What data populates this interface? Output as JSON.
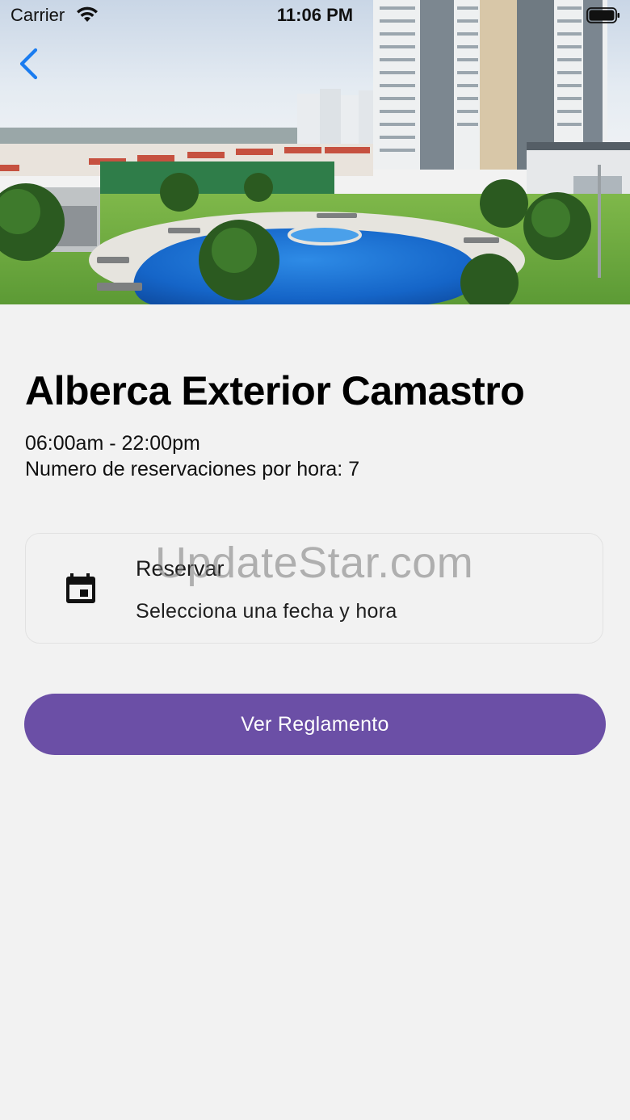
{
  "status_bar": {
    "carrier": "Carrier",
    "time": "11:06 PM"
  },
  "hero": {
    "icon": "pool-photo"
  },
  "nav": {
    "back_icon": "chevron-left-icon"
  },
  "amenity": {
    "title": "Alberca Exterior Camastro",
    "hours": "06:00am - 22:00pm",
    "per_hour_text": "Numero de reservaciones por hora: 7"
  },
  "reserve_card": {
    "icon": "calendar-icon",
    "title": "Reservar",
    "subtitle": "Selecciona una fecha y hora"
  },
  "rules_button": {
    "label": "Ver Reglamento"
  },
  "watermark": "UpdateStar.com",
  "colors": {
    "accent": "#6b4fa6",
    "back": "#1a7cf0",
    "background": "#f2f2f2"
  }
}
